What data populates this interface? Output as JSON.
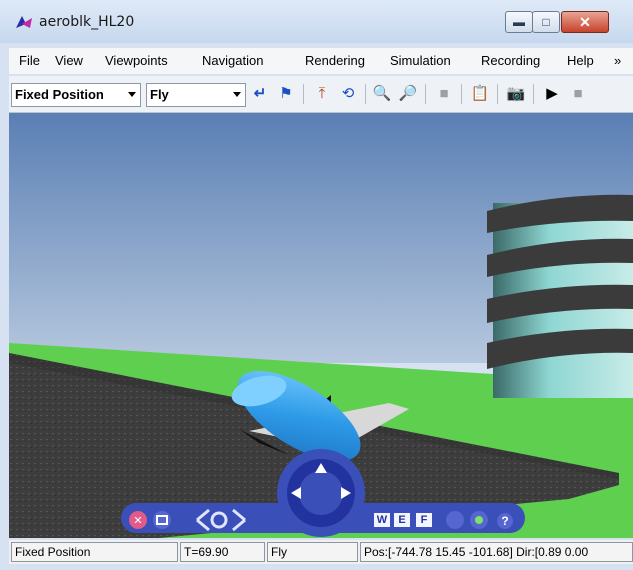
{
  "window": {
    "title": "aeroblk_HL20"
  },
  "menu": {
    "items": [
      "File",
      "View",
      "Viewpoints",
      "Navigation",
      "Rendering",
      "Simulation",
      "Recording",
      "Help"
    ],
    "overflow": "»"
  },
  "toolbar": {
    "viewpoint_select": "Fixed Position",
    "navigation_select": "Fly"
  },
  "navpanel": {
    "buttons": [
      "W",
      "E",
      "F"
    ],
    "help": "?"
  },
  "status": {
    "viewpoint": "Fixed Position",
    "time": "T=69.90",
    "mode": "Fly",
    "position": "Pos:[-744.78 15.45 -101.68] Dir:[0.89 0.00"
  },
  "colors": {
    "sky_top": "#5a7fb4",
    "sky_bottom": "#b4c6dd",
    "ground": "#5fcf50",
    "runway": "#3a3a3a",
    "aircraft": "#3aa4e8",
    "navpanel": "#3a4fb8"
  }
}
